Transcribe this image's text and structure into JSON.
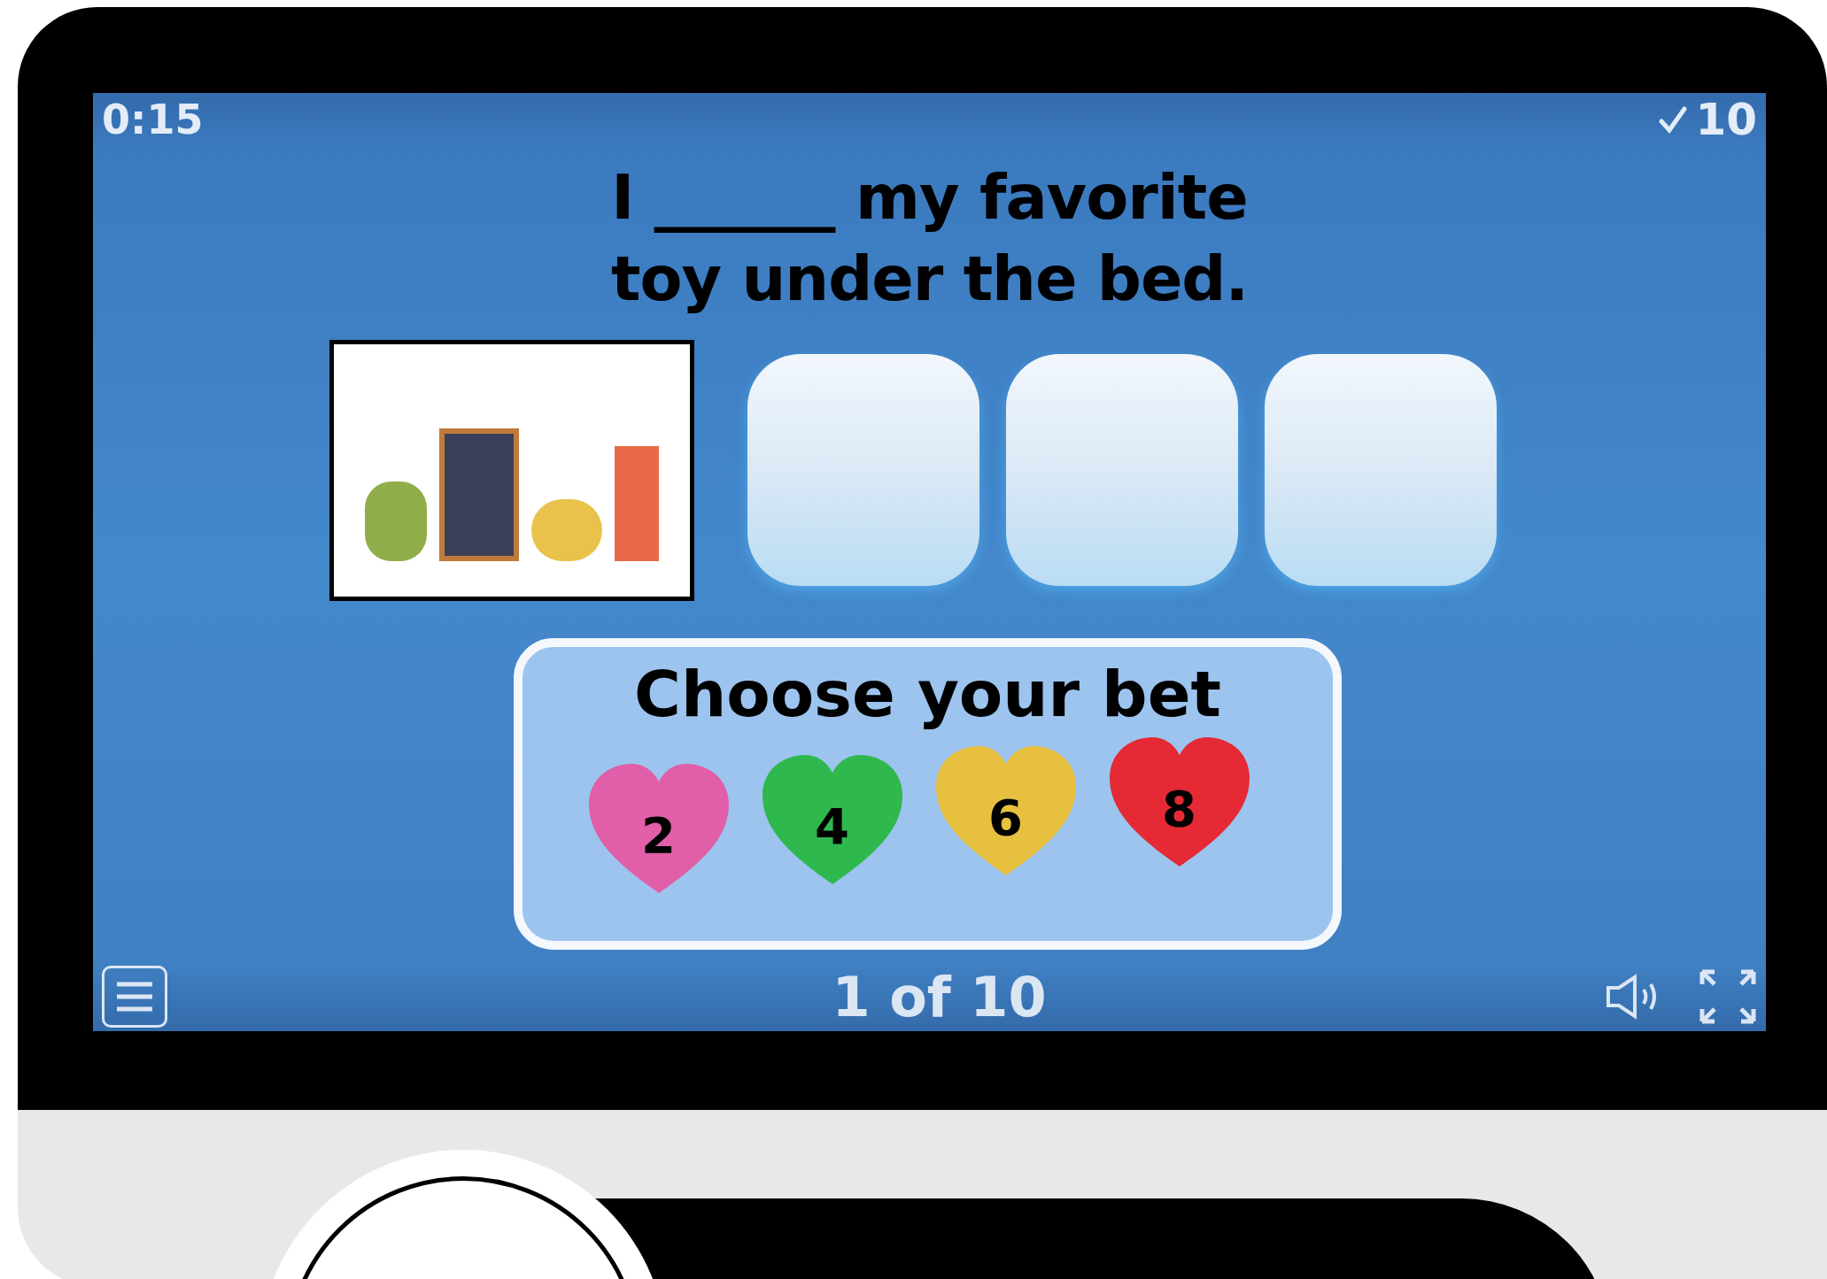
{
  "game": {
    "timer": "0:15",
    "score": "10",
    "question": [
      "I ______ my favorite",
      "toy under the bed."
    ],
    "bet_panel": {
      "title": "Choose your bet",
      "options": [
        {
          "value": "2",
          "color": "#e05fa8"
        },
        {
          "value": "4",
          "color": "#2fb84e"
        },
        {
          "value": "6",
          "color": "#e8c040"
        },
        {
          "value": "8",
          "color": "#e52a35"
        }
      ]
    },
    "progress": "1 of 10"
  }
}
